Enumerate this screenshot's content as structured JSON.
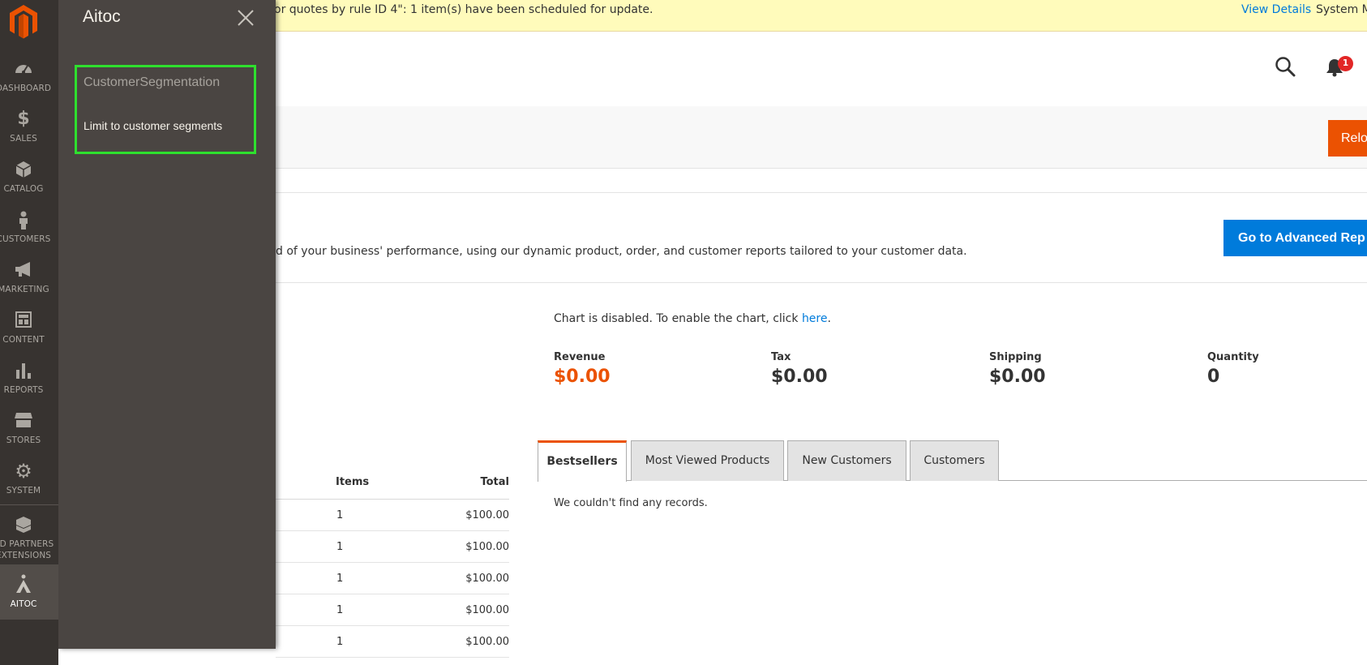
{
  "colors": {
    "nav_bg": "#373330",
    "flyout_bg": "#4a4542",
    "accent_orange": "#eb5202",
    "link_blue": "#007bdb",
    "highlight_green": "#2ee02e",
    "notice_bg": "#fffbbb"
  },
  "nav": {
    "logo_icon": "magento-logo-icon",
    "items": [
      {
        "label": "DASHBOARD",
        "icon": "dashboard-gauge-icon"
      },
      {
        "label": "SALES",
        "icon": "dollar-icon"
      },
      {
        "label": "CATALOG",
        "icon": "cube-icon"
      },
      {
        "label": "CUSTOMERS",
        "icon": "person-icon"
      },
      {
        "label": "MARKETING",
        "icon": "megaphone-icon"
      },
      {
        "label": "CONTENT",
        "icon": "layout-icon"
      },
      {
        "label": "REPORTS",
        "icon": "bar-chart-icon"
      },
      {
        "label": "STORES",
        "icon": "storefront-icon"
      },
      {
        "label": "SYSTEM",
        "icon": "gear-icon"
      },
      {
        "label_line1": "ND PARTNERS",
        "label_line2": "EXTENSIONS",
        "icon": "boxes-icon"
      },
      {
        "label": "AITOC",
        "icon": "aitoc-icon"
      }
    ]
  },
  "flyout": {
    "title": "Aitoc",
    "section": "CustomerSegmentation",
    "link": "Limit to customer segments"
  },
  "notice": {
    "text": "or quotes by rule ID 4\": 1 item(s) have been scheduled for update.",
    "view_details": "View Details",
    "system": "System M"
  },
  "header": {
    "notification_count": "1"
  },
  "actions": {
    "reload": "Relo"
  },
  "advanced": {
    "text": "d of your business' performance, using our dynamic product, order, and customer reports tailored to your customer data.",
    "button": "Go to Advanced Rep"
  },
  "chart": {
    "msg": "Chart is disabled. To enable the chart, click ",
    "link": "here",
    "period": "."
  },
  "totals": {
    "revenue_label": "Revenue",
    "revenue": "$0.00",
    "tax_label": "Tax",
    "tax": "$0.00",
    "shipping_label": "Shipping",
    "shipping": "$0.00",
    "quantity_label": "Quantity",
    "quantity": "0"
  },
  "last_orders": {
    "headers": {
      "items": "Items",
      "total": "Total"
    },
    "rows": [
      {
        "items": "1",
        "total": "$100.00"
      },
      {
        "items": "1",
        "total": "$100.00"
      },
      {
        "items": "1",
        "total": "$100.00"
      },
      {
        "items": "1",
        "total": "$100.00"
      },
      {
        "items": "1",
        "total": "$100.00"
      }
    ]
  },
  "tabs": [
    "Bestsellers",
    "Most Viewed Products",
    "New Customers",
    "Customers"
  ],
  "no_records": "We couldn't find any records."
}
